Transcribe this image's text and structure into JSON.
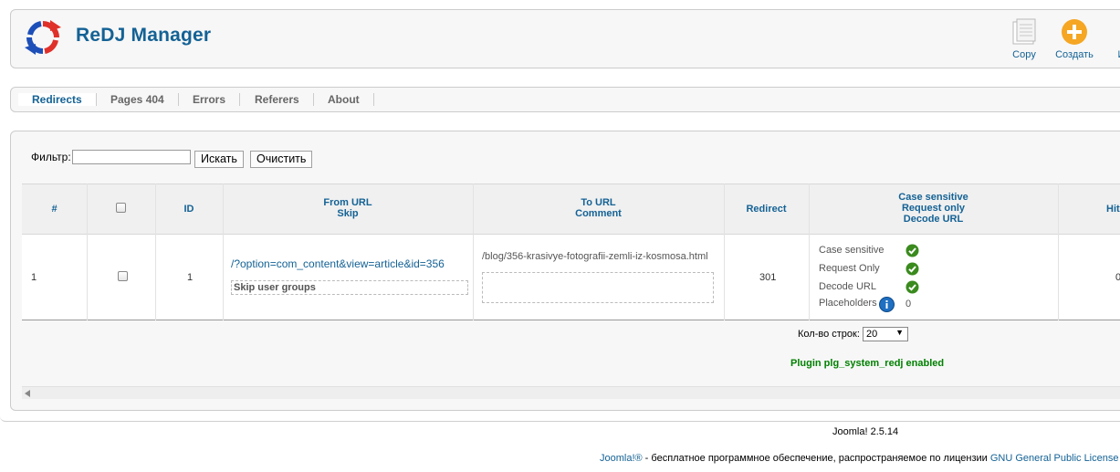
{
  "app": {
    "title": "ReDJ Manager",
    "icon": "redj-logo-icon"
  },
  "toolbar": {
    "copy_label": "Copy",
    "create_label": "Создать",
    "edit_label": "Из"
  },
  "tabs": [
    {
      "label": "Redirects",
      "active": true
    },
    {
      "label": "Pages 404"
    },
    {
      "label": "Errors"
    },
    {
      "label": "Referers"
    },
    {
      "label": "About"
    }
  ],
  "filter": {
    "label": "Фильтр:",
    "value": "",
    "search_button": "Искать",
    "clear_button": "Очистить"
  },
  "table": {
    "headers": {
      "num": "#",
      "id": "ID",
      "from_url": "From URL",
      "skip": "Skip",
      "to_url": "To URL",
      "comment": "Comment",
      "redirect": "Redirect",
      "case_sensitive": "Case sensitive",
      "request_only": "Request only",
      "decode_url": "Decode URL",
      "hits": "Hit"
    },
    "rows": [
      {
        "num": "1",
        "id": "1",
        "from_url": "/?option=com_content&view=article&id=356",
        "skip": "Skip user groups",
        "to_url": "/blog/356-krasivye-fotografii-zemli-iz-kosmosa.html",
        "comment": "",
        "redirect": "301",
        "flags": {
          "case_sensitive": "Case sensitive",
          "request_only": "Request Only",
          "decode_url": "Decode URL",
          "placeholders": "Placeholders",
          "placeholders_value": "0"
        },
        "hits": "0"
      }
    ]
  },
  "pagination": {
    "rows_label": "Кол-во строк:",
    "rows_value": "20"
  },
  "status": {
    "plugin": "Plugin plg_system_redj enabled"
  },
  "footer": {
    "version": "Joomla! 2.5.14",
    "license_link1": "Joomla!®",
    "license_text": " - бесплатное программное обеспечение, распространяемое по лицензии ",
    "license_link2": "GNU General Public License"
  },
  "colors": {
    "accent": "#146295",
    "ok": "#3a8a1e",
    "status_green": "#008000",
    "create_orange": "#f5a623"
  }
}
